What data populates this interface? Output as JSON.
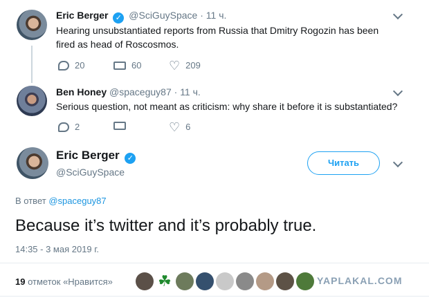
{
  "tweet1": {
    "name": "Eric Berger",
    "handle": "@SciGuySpace",
    "time": "11 ч.",
    "text": "Hearing unsubstantiated reports from Russia that Dmitry Rogozin has been fired as head of Roscosmos.",
    "replies": "20",
    "retweets": "60",
    "likes": "209"
  },
  "tweet2": {
    "name": "Ben Honey",
    "handle": "@spaceguy87",
    "time": "11 ч.",
    "text": "Serious question, not meant as criticism: why share it before it is substantiated?",
    "replies": "2",
    "retweets": "",
    "likes": "6"
  },
  "main": {
    "name": "Eric Berger",
    "handle": "@SciGuySpace",
    "follow_label": "Читать",
    "reply_prefix": "В ответ",
    "reply_handle": "@spaceguy87",
    "text": "Because it’s twitter and it’s probably true.",
    "timestamp": "14:35 - 3 мая 2019 г.",
    "likes_count": "19",
    "likes_label": "отметок «Нравится»"
  },
  "watermark": "YAPLAKAL.COM",
  "colors": {
    "accent": "#1da1f2",
    "link": "#1b95e0",
    "muted": "#657786",
    "text": "#14171a",
    "divider": "#e6ecf0"
  },
  "icons": {
    "reply": "reply-icon",
    "retweet": "retweet-icon",
    "like": "heart-icon",
    "verified": "verified-badge-icon",
    "menu": "chevron-down-icon"
  }
}
